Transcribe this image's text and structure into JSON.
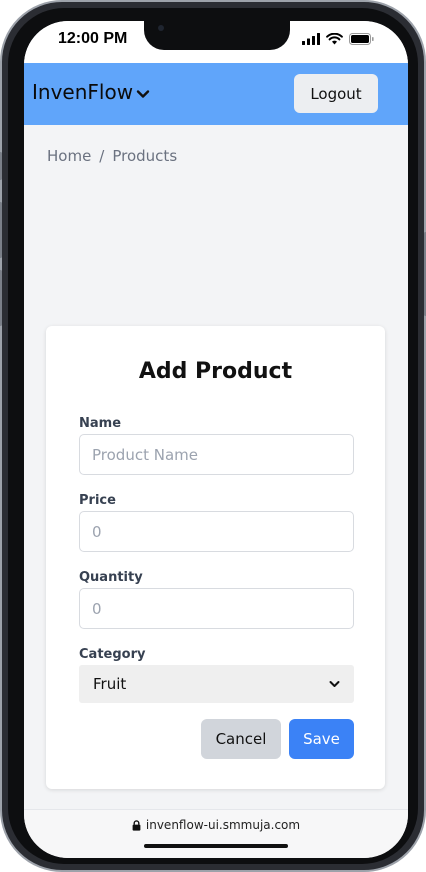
{
  "status_bar": {
    "time": "12:00 PM",
    "icons": [
      "signal-icon",
      "wifi-icon",
      "battery-icon"
    ]
  },
  "header": {
    "brand": "InvenFlow",
    "brand_icon": "chevron-down-icon",
    "logout_label": "Logout",
    "background_color": "#60a5fa"
  },
  "breadcrumb": {
    "items": [
      "Home",
      "Products"
    ],
    "separator": "/"
  },
  "form": {
    "title": "Add Product",
    "name": {
      "label": "Name",
      "value": "",
      "placeholder": "Product Name"
    },
    "price": {
      "label": "Price",
      "value": "",
      "placeholder": "0"
    },
    "quantity": {
      "label": "Quantity",
      "value": "",
      "placeholder": "0"
    },
    "category": {
      "label": "Category",
      "selected": "Fruit"
    },
    "cancel_label": "Cancel",
    "save_label": "Save",
    "save_color": "#3b82f6"
  },
  "address_bar": {
    "url": "invenflow-ui.smmuja.com",
    "icon": "lock-icon"
  }
}
